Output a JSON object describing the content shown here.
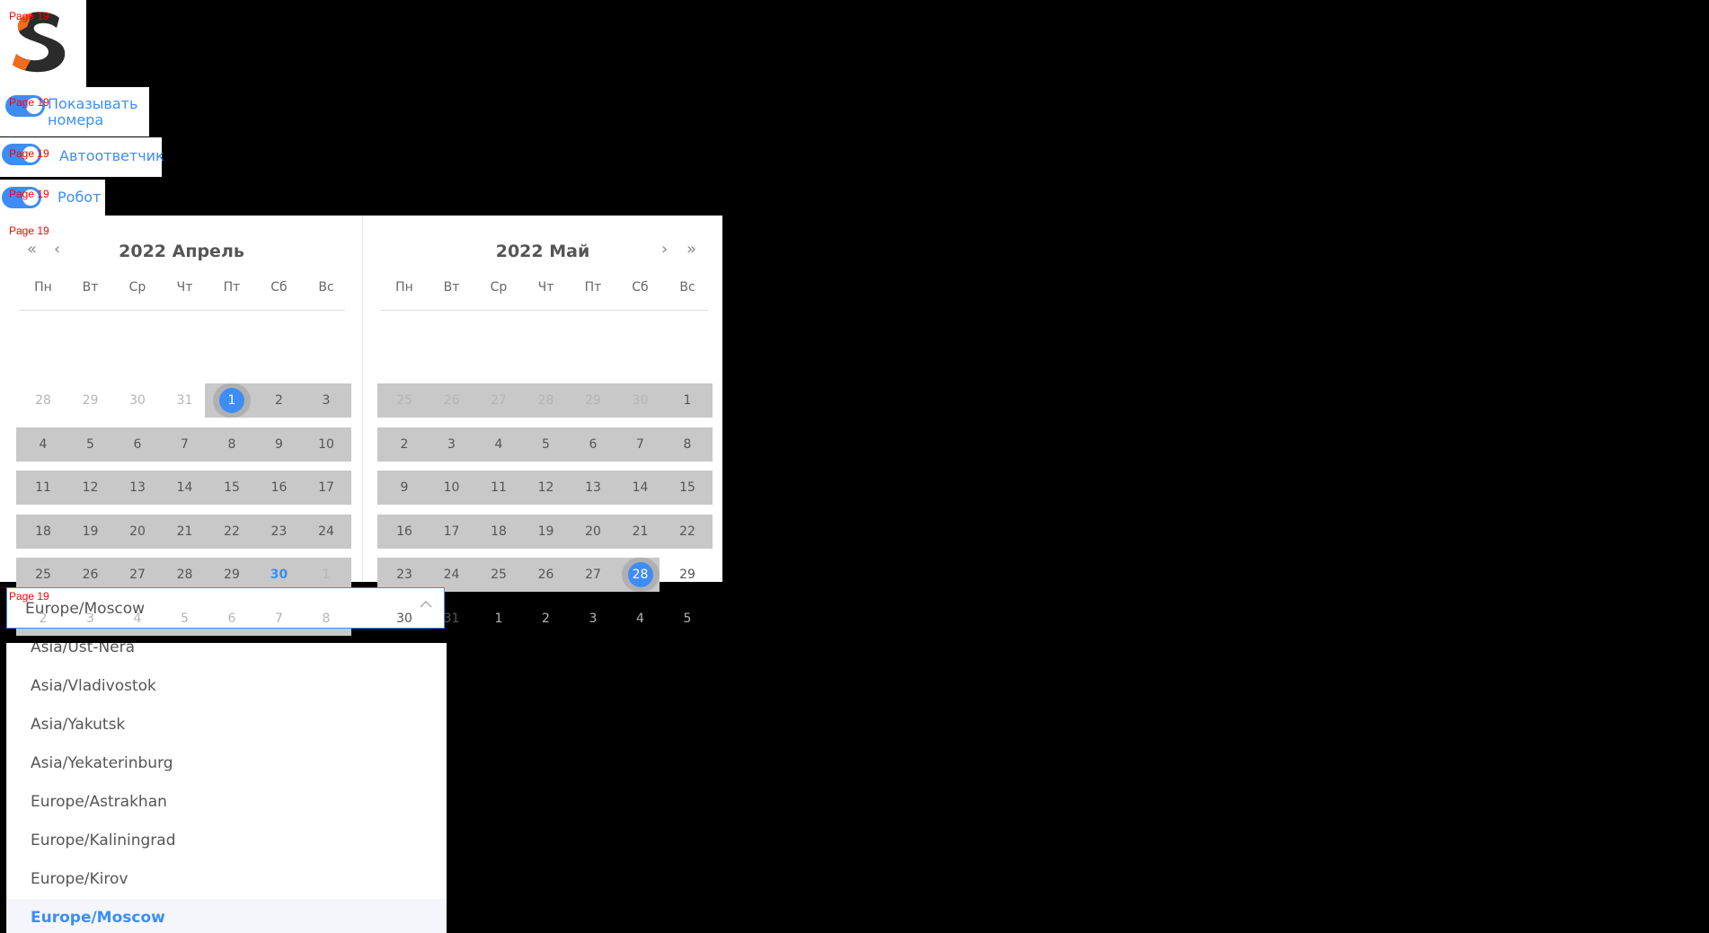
{
  "page_tag": "Page 19",
  "logo": {
    "letter": "S",
    "colors": {
      "primary": "#2b2b2b",
      "accent": "#f26b1d"
    }
  },
  "toggles": [
    {
      "label_line1": "Показывать",
      "label_line2": "номера",
      "on": true
    },
    {
      "label": "Автоответчик",
      "on": true
    },
    {
      "label": "Робот",
      "on": true
    }
  ],
  "calendar": {
    "left": {
      "title": "2022 Апрель",
      "weekdays": [
        "Пн",
        "Вт",
        "Ср",
        "Чт",
        "Пт",
        "Сб",
        "Вс"
      ],
      "weeks": [
        [
          "28",
          "29",
          "30",
          "31",
          "1",
          "2",
          "3"
        ],
        [
          "4",
          "5",
          "6",
          "7",
          "8",
          "9",
          "10"
        ],
        [
          "11",
          "12",
          "13",
          "14",
          "15",
          "16",
          "17"
        ],
        [
          "18",
          "19",
          "20",
          "21",
          "22",
          "23",
          "24"
        ],
        [
          "25",
          "26",
          "27",
          "28",
          "29",
          "30",
          "1"
        ],
        [
          "2",
          "3",
          "4",
          "5",
          "6",
          "7",
          "8"
        ]
      ]
    },
    "right": {
      "title": "2022 Май",
      "weekdays": [
        "Пн",
        "Вт",
        "Ср",
        "Чт",
        "Пт",
        "Сб",
        "Вс"
      ],
      "weeks": [
        [
          "25",
          "26",
          "27",
          "28",
          "29",
          "30",
          "1"
        ],
        [
          "2",
          "3",
          "4",
          "5",
          "6",
          "7",
          "8"
        ],
        [
          "9",
          "10",
          "11",
          "12",
          "13",
          "14",
          "15"
        ],
        [
          "16",
          "17",
          "18",
          "19",
          "20",
          "21",
          "22"
        ],
        [
          "23",
          "24",
          "25",
          "26",
          "27",
          "28",
          "29"
        ],
        [
          "30",
          "31",
          "1",
          "2",
          "3",
          "4",
          "5"
        ]
      ]
    },
    "range_start": "2022-04-01",
    "range_end": "2022-05-28",
    "today": "2022-04-30",
    "nav": {
      "prev_year": "«",
      "prev_month": "‹",
      "next_month": "›",
      "next_year": "»"
    },
    "colors": {
      "accent": "#3d8df5",
      "range": "#c8c8c8"
    }
  },
  "timezone": {
    "value": "Europe/Moscow",
    "options": [
      "Asia/Ust-Nera",
      "Asia/Vladivostok",
      "Asia/Yakutsk",
      "Asia/Yekaterinburg",
      "Europe/Astrakhan",
      "Europe/Kaliningrad",
      "Europe/Kirov",
      "Europe/Moscow"
    ],
    "selected": "Europe/Moscow"
  }
}
